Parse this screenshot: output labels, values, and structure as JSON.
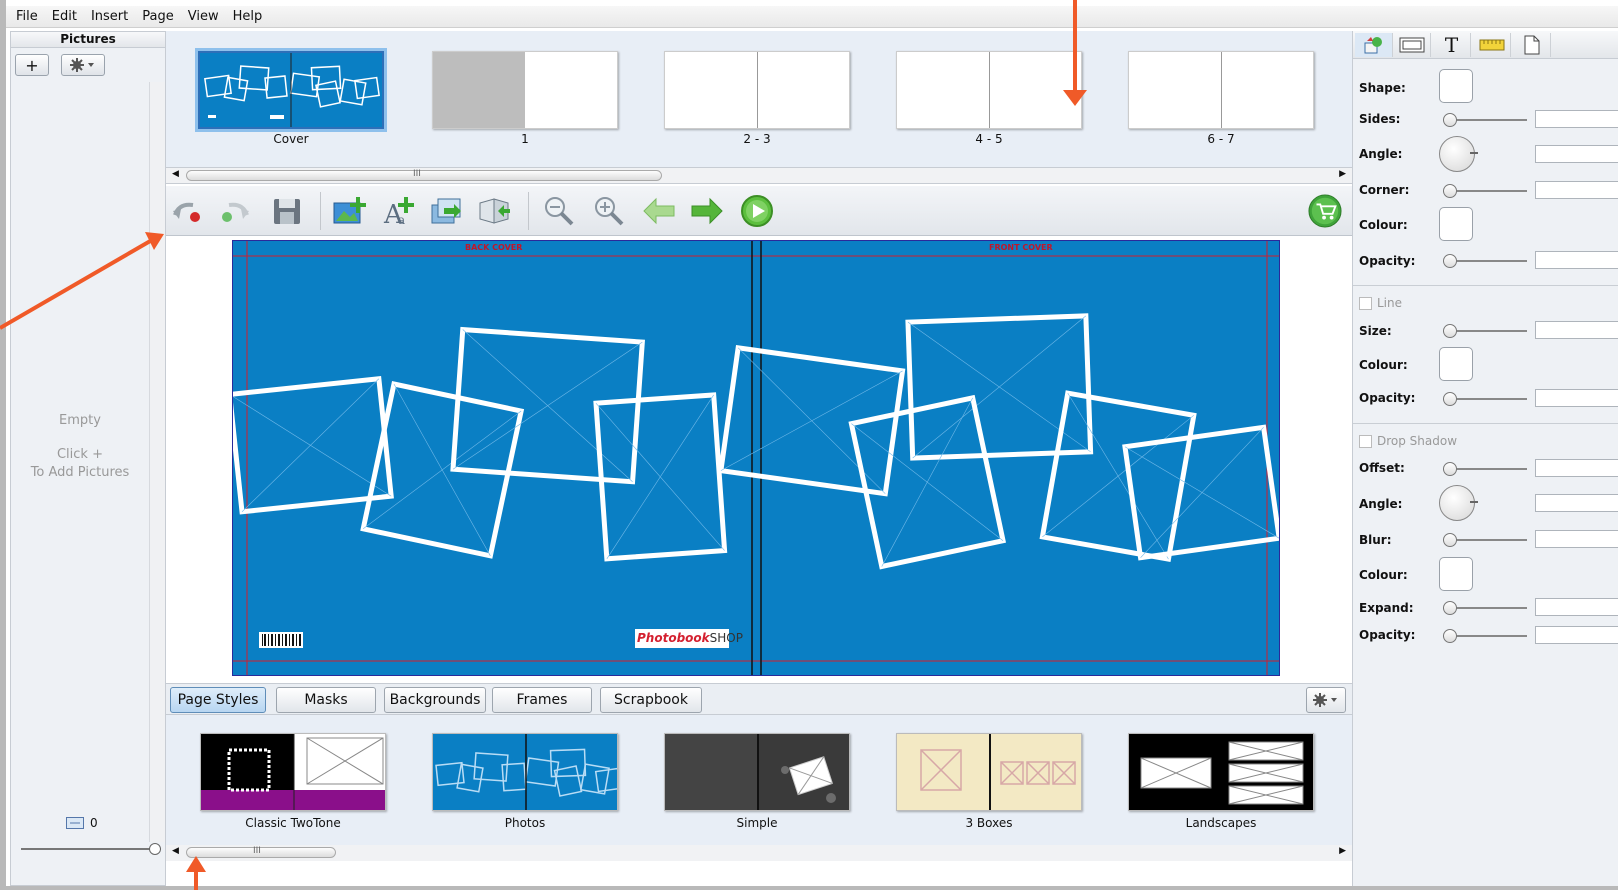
{
  "menu": [
    "File",
    "Edit",
    "Insert",
    "Page",
    "View",
    "Help"
  ],
  "left_panel": {
    "title": "Pictures",
    "add_label": "+",
    "empty_text": "Empty",
    "hint_line1": "Click +",
    "hint_line2": "To Add Pictures",
    "count": "0"
  },
  "pages": [
    {
      "label": "Cover"
    },
    {
      "label": "1"
    },
    {
      "label": "2 - 3"
    },
    {
      "label": "4 - 5"
    },
    {
      "label": "6 - 7"
    }
  ],
  "thumb_scroll_grip": "III",
  "toolbar": {
    "icons": [
      "undo-icon",
      "redo-icon",
      "save-icon",
      "add-picture-icon",
      "add-text-icon",
      "import-icon",
      "swap-page-icon",
      "zoom-out-icon",
      "zoom-in-icon",
      "previous-page-icon",
      "next-page-icon",
      "preview-icon"
    ],
    "cart_icon": "shopping-cart-icon"
  },
  "canvas": {
    "back_cover_title": "BACK COVER",
    "front_cover_title": "FRONT COVER",
    "logo_brand": "Photobook",
    "logo_suffix": "SHOP",
    "background_color": "#0a7fc4"
  },
  "tabs": [
    "Page Styles",
    "Masks",
    "Backgrounds",
    "Frames",
    "Scrapbook"
  ],
  "active_tab": "Page Styles",
  "styles": [
    {
      "label": "Classic TwoTone"
    },
    {
      "label": "Photos"
    },
    {
      "label": "Simple"
    },
    {
      "label": "3 Boxes"
    },
    {
      "label": "Landscapes"
    }
  ],
  "style_scroll_grip": "III",
  "properties": {
    "tabs": [
      "shape-tool-icon",
      "frame-tool-icon",
      "text-tool-icon",
      "ruler-tool-icon",
      "page-tool-icon"
    ],
    "text_tab_glyph": "T",
    "shape": "Shape:",
    "sides": "Sides:",
    "angle": "Angle:",
    "corner": "Corner:",
    "colour": "Colour:",
    "opacity": "Opacity:",
    "line_section": "Line",
    "size": "Size:",
    "line_colour": "Colour:",
    "line_opacity": "Opacity:",
    "shadow_section": "Drop Shadow",
    "offset": "Offset:",
    "shadow_angle": "Angle:",
    "blur": "Blur:",
    "shadow_colour": "Colour:",
    "expand": "Expand:",
    "shadow_opacity": "Opacity:"
  },
  "accent_color": "#f05a28"
}
